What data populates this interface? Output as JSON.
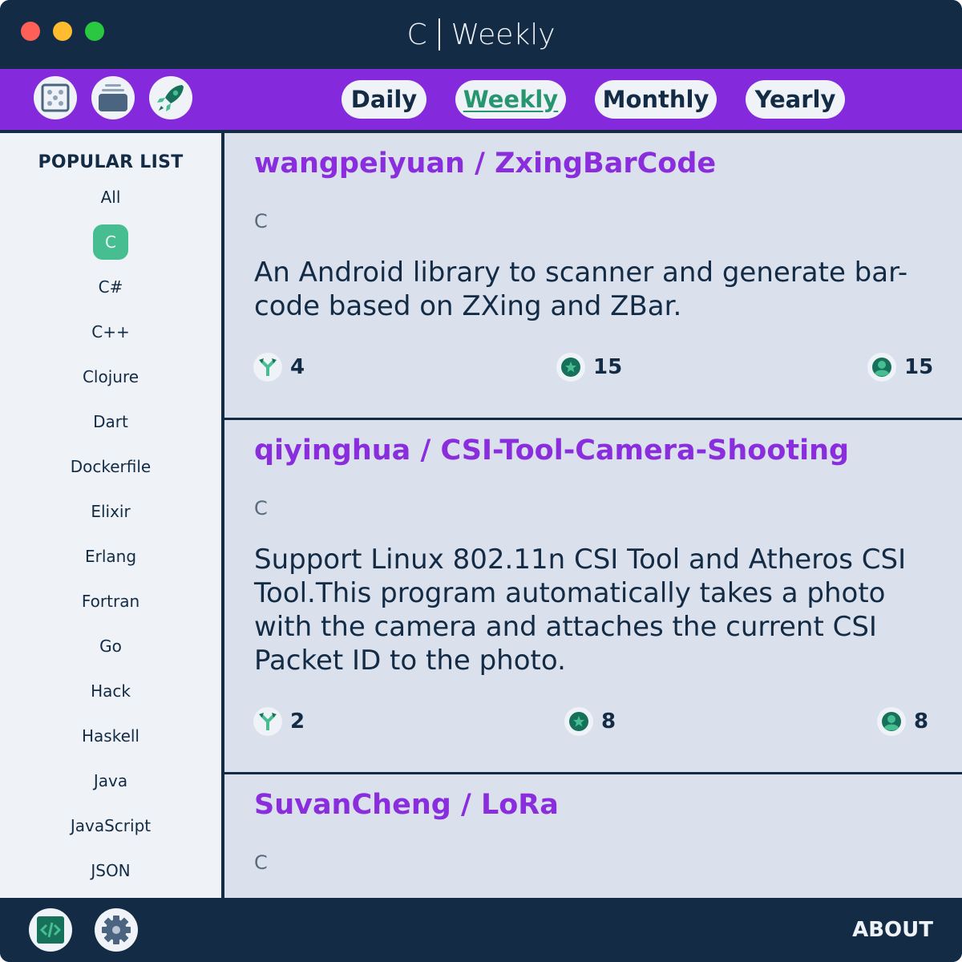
{
  "window": {
    "title_language": "C",
    "title_period": "Weekly"
  },
  "toolbar": {
    "icons": [
      "dice-icon",
      "archive-icon",
      "rocket-icon"
    ],
    "tabs": [
      {
        "label": "Daily",
        "active": false
      },
      {
        "label": "Weekly",
        "active": true
      },
      {
        "label": "Monthly",
        "active": false
      },
      {
        "label": "Yearly",
        "active": false
      }
    ]
  },
  "sidebar": {
    "title": "POPULAR LIST",
    "items": [
      {
        "label": "All"
      },
      {
        "label": "C",
        "active": true
      },
      {
        "label": "C#"
      },
      {
        "label": "C++"
      },
      {
        "label": "Clojure"
      },
      {
        "label": "Dart"
      },
      {
        "label": "Dockerfile"
      },
      {
        "label": "Elixir"
      },
      {
        "label": "Erlang"
      },
      {
        "label": "Fortran"
      },
      {
        "label": "Go"
      },
      {
        "label": "Hack"
      },
      {
        "label": "Haskell"
      },
      {
        "label": "Java"
      },
      {
        "label": "JavaScript"
      },
      {
        "label": "JSON"
      }
    ]
  },
  "repos": [
    {
      "title": "wangpeiyuan / ZxingBarCode",
      "language": "C",
      "description": "An Android library to scanner and generate bar-code based on ZXing and ZBar.",
      "forks": "4",
      "stars": "15",
      "watchers": "15"
    },
    {
      "title": "qiyinghua / CSI-Tool-Camera-Shooting",
      "language": "C",
      "description": "Support Linux 802.11n CSI Tool and Atheros CSI Tool.This program automatically takes a photo with the camera and attaches the current CSI Packet ID to the photo.",
      "forks": "2",
      "stars": "8",
      "watchers": "8"
    },
    {
      "title": "SuvanCheng / LoRa",
      "language": "C"
    }
  ],
  "bottombar": {
    "about_label": "ABOUT",
    "icons": [
      "code-icon",
      "gear-icon"
    ]
  },
  "colors": {
    "navy": "#132b45",
    "purple": "#8529dd",
    "green": "#46be92",
    "dark_green": "#16705a",
    "panel": "#eff3f8",
    "content_bg": "#dae1ec"
  }
}
